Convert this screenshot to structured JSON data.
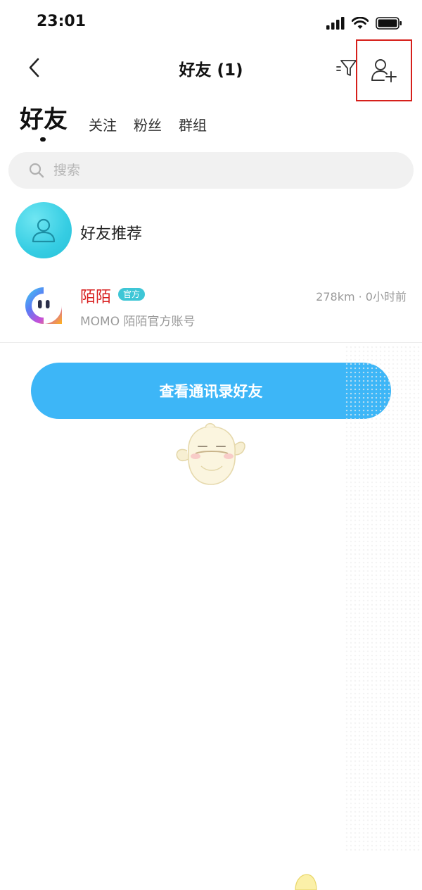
{
  "status": {
    "time": "23:01",
    "icons": [
      "signal-icon",
      "wifi-icon",
      "battery-icon"
    ]
  },
  "nav": {
    "title": "好友 (1)",
    "back_icon": "chevron-left-icon",
    "filter_icon": "filter-icon",
    "add_friend_icon": "add-user-icon",
    "highlight_color": "#d6201b"
  },
  "tabs": [
    {
      "label": "好友",
      "active": true
    },
    {
      "label": "关注",
      "active": false
    },
    {
      "label": "粉丝",
      "active": false
    },
    {
      "label": "群组",
      "active": false
    }
  ],
  "search": {
    "placeholder": "搜索",
    "value": ""
  },
  "recommend": {
    "label": "好友推荐",
    "avatar_color": "#36cde3"
  },
  "contacts": [
    {
      "name": "陌陌",
      "badge": "官方",
      "meta": "278km · 0小时前",
      "subtitle": "MOMO 陌陌官方账号",
      "name_color": "#d81e1e",
      "badge_color": "#3ec6d6"
    }
  ],
  "action": {
    "label": "查看通讯录好友",
    "color": "#3db6f7"
  }
}
